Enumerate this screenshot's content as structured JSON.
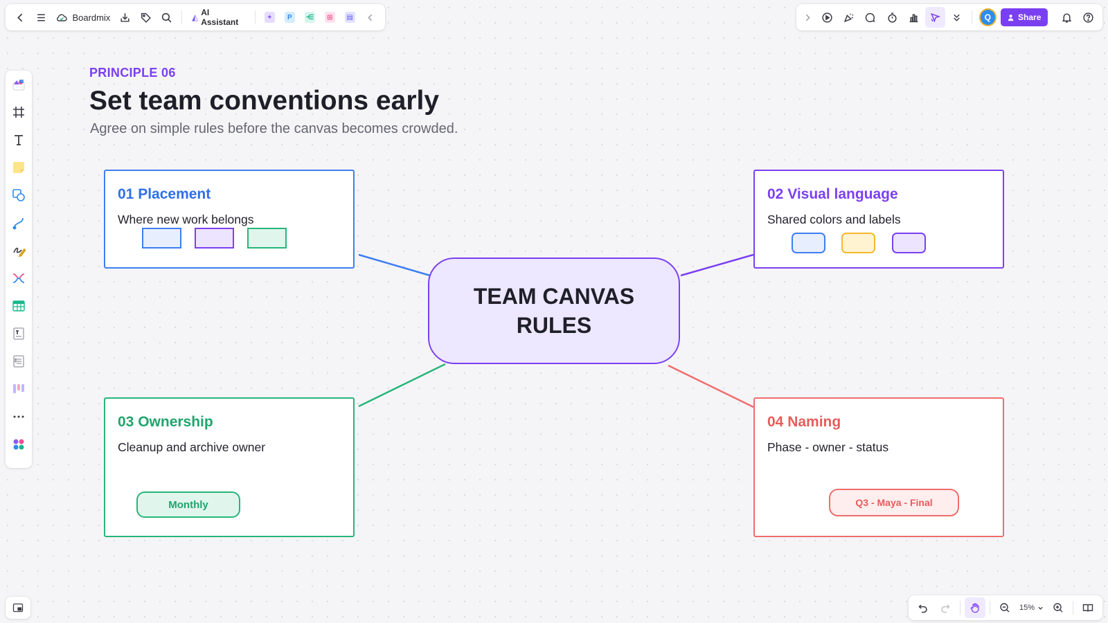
{
  "app": {
    "brand_name": "Boardmix",
    "ai_assistant_label": "AI Assistant",
    "share_label": "Share",
    "avatar_initial": "Q",
    "zoom_level": "15%"
  },
  "board": {
    "principle": "PRINCIPLE 06",
    "title": "Set team conventions early",
    "subtitle": "Agree on simple rules before the canvas becomes crowded.",
    "center_line_1": "TEAM CANVAS",
    "center_line_2": "RULES",
    "cards": [
      {
        "title": "01  Placement",
        "desc": "Where new work belongs",
        "color": "#3e7ef0"
      },
      {
        "title": "02  Visual language",
        "desc": "Shared colors and labels",
        "color": "#7b3ff2"
      },
      {
        "title": "03  Ownership",
        "desc": "Cleanup and archive owner",
        "chip": "Monthly",
        "color": "#26b57a"
      },
      {
        "title": "04  Naming",
        "desc": "Phase - owner - status",
        "chip": "Q3 - Maya - Final",
        "color": "#ef6d6d"
      }
    ]
  },
  "colors": {
    "accent": "#7b3ff2",
    "blue": "#3e7ef0",
    "green": "#26b57a",
    "red": "#ef6d6d",
    "yellow": "#f5b82e"
  }
}
